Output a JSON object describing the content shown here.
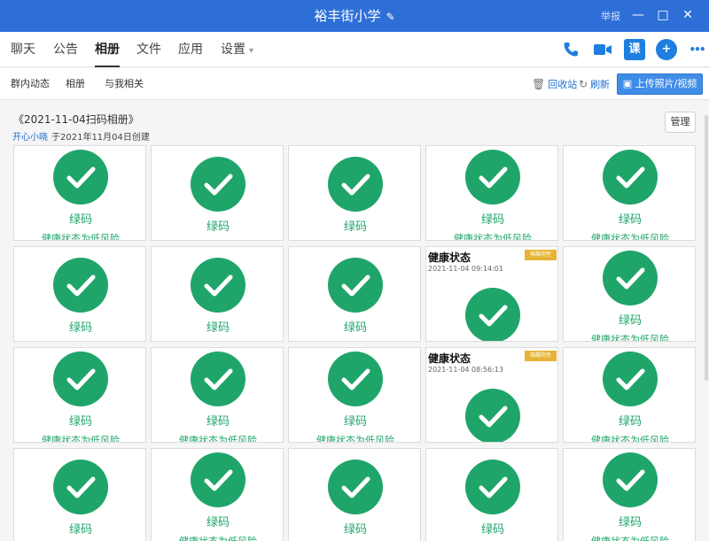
{
  "window": {
    "title": "裕丰街小学",
    "report_label": "举报",
    "controls": {
      "minimize": "—",
      "maximize": "□",
      "close": "✕"
    }
  },
  "tabs": [
    {
      "label": "聊天"
    },
    {
      "label": "公告"
    },
    {
      "label": "相册",
      "active": true
    },
    {
      "label": "文件"
    },
    {
      "label": "应用"
    },
    {
      "label": "设置"
    }
  ],
  "toolbar_icons": [
    "phone-icon",
    "video-icon",
    "class-icon",
    "add-icon",
    "more-icon"
  ],
  "toolbar_icon_text": {
    "class": "课",
    "add": "+",
    "more": "•••"
  },
  "subtabs": [
    "群内动态",
    "相册",
    "与我相关"
  ],
  "actions": {
    "recycle": "回收站",
    "refresh": "刷新",
    "upload": "上传照片/视频"
  },
  "album": {
    "title": "《2021-11-04扫码相册》",
    "creator": "开心小晓",
    "created_text": "于2021年11月04日创建",
    "manage_label": "管理"
  },
  "photos": [
    {
      "label": "绿码",
      "sub": "健康状态为低风险"
    },
    {
      "label": "绿码"
    },
    {
      "label": "绿码"
    },
    {
      "label": "绿码",
      "sub": "健康状态为低风险"
    },
    {
      "label": "绿码",
      "sub": "健康状态为低风险"
    },
    {
      "label": "绿码"
    },
    {
      "label": "绿码"
    },
    {
      "label": "绿码"
    },
    {
      "card_title": "健康状态",
      "time": "2021-11-04 09:14:01",
      "badge": "核酸阴性"
    },
    {
      "label": "绿码",
      "sub": "健康状态为低风险"
    },
    {
      "label": "绿码",
      "sub": "健康状态为低风险"
    },
    {
      "label": "绿码",
      "sub": "健康状态为低风险"
    },
    {
      "label": "绿码",
      "sub": "健康状态为低风险"
    },
    {
      "card_title": "健康状态",
      "time": "2021-11-04 08:56:13",
      "badge": "核酸阴性"
    },
    {
      "label": "绿码",
      "sub": "健康状态为低风险"
    },
    {
      "label": "绿码"
    },
    {
      "label": "绿码",
      "sub": "健康状态为低风险"
    },
    {
      "label": "绿码"
    },
    {
      "label": "绿码"
    },
    {
      "label": "绿码",
      "sub": "健康状态为低风险"
    }
  ],
  "colors": {
    "accent": "#2d6fd7",
    "green_code": "#1fa56a",
    "link": "#1f6fd0"
  }
}
